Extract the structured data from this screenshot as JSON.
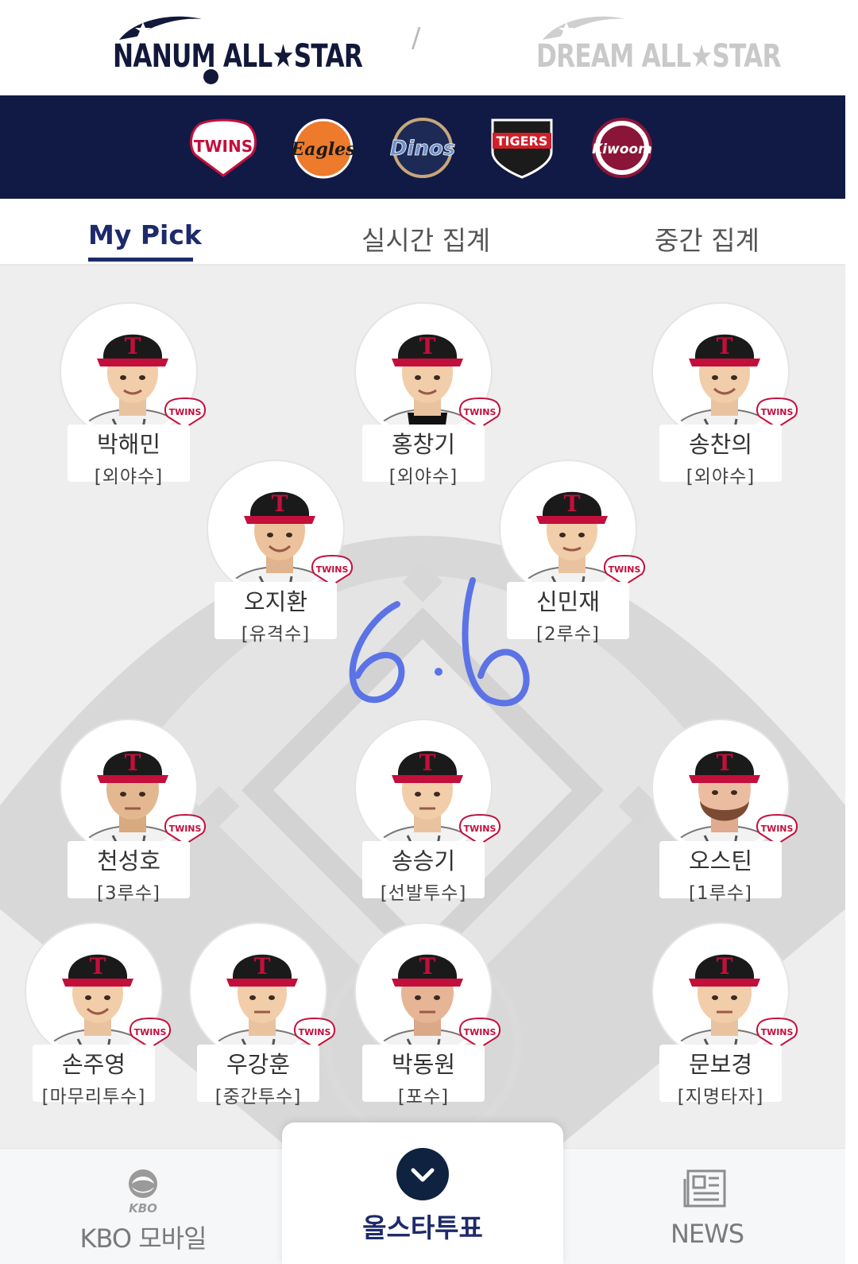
{
  "header": {
    "brand_left": "NANUM ALL★STAR",
    "brand_separator": "/",
    "brand_right": "DREAM ALL★STAR"
  },
  "teams": [
    {
      "name": "LG TWINS",
      "label": "TWINS"
    },
    {
      "name": "Eagles",
      "label": "Eagles"
    },
    {
      "name": "NC Dinos",
      "label": "Dinos"
    },
    {
      "name": "Tigers",
      "label": "TIGERS"
    },
    {
      "name": "Kiwoom",
      "label": "Kiwoom"
    }
  ],
  "tabs": [
    {
      "label": "My Pick",
      "active": true
    },
    {
      "label": "실시간 집계",
      "active": false
    },
    {
      "label": "중간 집계",
      "active": false
    }
  ],
  "players": [
    {
      "name": "박해민",
      "position": "[외야수]",
      "team_badge": "TWINS"
    },
    {
      "name": "홍창기",
      "position": "[외야수]",
      "team_badge": "TWINS"
    },
    {
      "name": "송찬의",
      "position": "[외야수]",
      "team_badge": "TWINS"
    },
    {
      "name": "오지환",
      "position": "[유격수]",
      "team_badge": "TWINS"
    },
    {
      "name": "신민재",
      "position": "[2루수]",
      "team_badge": "TWINS"
    },
    {
      "name": "천성호",
      "position": "[3루수]",
      "team_badge": "TWINS"
    },
    {
      "name": "송승기",
      "position": "[선발투수]",
      "team_badge": "TWINS"
    },
    {
      "name": "오스틴",
      "position": "[1루수]",
      "team_badge": "TWINS"
    },
    {
      "name": "손주영",
      "position": "[마무리투수]",
      "team_badge": "TWINS"
    },
    {
      "name": "우강훈",
      "position": "[중간투수]",
      "team_badge": "TWINS"
    },
    {
      "name": "박동원",
      "position": "[포수]",
      "team_badge": "TWINS"
    },
    {
      "name": "문보경",
      "position": "[지명타자]",
      "team_badge": "TWINS"
    }
  ],
  "annotation": {
    "text": "6.6",
    "color": "#5b73e6"
  },
  "bottom_nav": {
    "kbo": {
      "icon_text": "KBO",
      "label": "KBO 모바일"
    },
    "vote": {
      "label": "올스타투표"
    },
    "news": {
      "label": "NEWS"
    }
  },
  "colors": {
    "navy": "#111a45",
    "tab_active": "#1d2a6b",
    "field_bg": "#eeeeee",
    "cap_black": "#1a1a1a",
    "twins_red": "#c30f3c"
  }
}
